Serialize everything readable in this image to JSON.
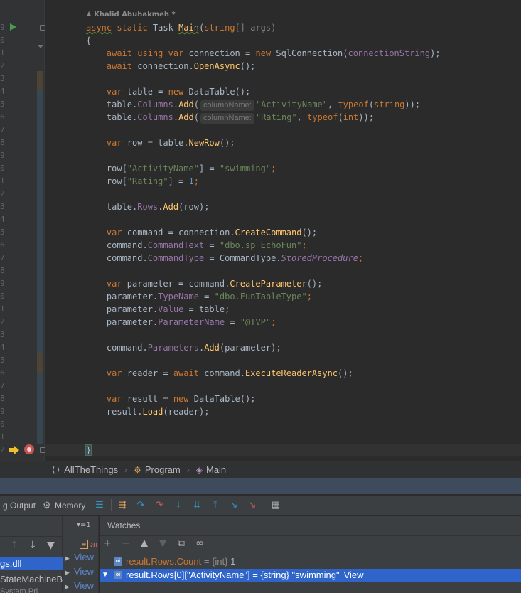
{
  "editor": {
    "author": "Khalid Abuhakmeh *",
    "line_numbers": [
      "9",
      "0",
      "1",
      "2",
      "3",
      "4",
      "5",
      "6",
      "7",
      "8",
      "9",
      "0",
      "1",
      "2",
      "3",
      "4",
      "5",
      "6",
      "7",
      "8",
      "9",
      "0",
      "1",
      "2",
      "3",
      "4",
      "5",
      "6",
      "7",
      "8",
      "9",
      "0",
      "1",
      "2"
    ],
    "code": {
      "l1_async": "async",
      "l1_static": " static",
      "l1_task": " Task ",
      "l1_main": "Main",
      "l1_paren": "(",
      "l1_string": "string",
      "l1_rest": "[] args)",
      "l2": "{",
      "l3_await": "    await",
      "l3_using": " using",
      "l3_var": " var",
      "l3_mid": " connection = ",
      "l3_new": "new",
      "l3_type": " SqlConnection(",
      "l3_arg": "connectionString",
      "l3_end": ");",
      "l4_await": "    await",
      "l4_mid": " connection.",
      "l4_fn": "OpenAsync",
      "l4_end": "();",
      "l5_var": "    var",
      "l5_mid": " table = ",
      "l5_new": "new",
      "l5_end": " DataTable();",
      "l6_a": "    table.",
      "l6_prop": "Columns",
      "l6_dot": ".",
      "l6_fn": "Add",
      "l6_paren": "(",
      "l6_hint": "columnName:",
      "l6_str": "\"ActivityName\"",
      "l6_comma": ", ",
      "l6_typeof": "typeof",
      "l6_p": "(",
      "l6_kw": "string",
      "l6_end": "));",
      "l7_a": "    table.",
      "l7_prop": "Columns",
      "l7_dot": ".",
      "l7_fn": "Add",
      "l7_paren": "(",
      "l7_hint": "columnName:",
      "l7_str": "\"Rating\"",
      "l7_comma": ", ",
      "l7_typeof": "typeof",
      "l7_p": "(",
      "l7_kw": "int",
      "l7_end": "));",
      "l8_var": "    var",
      "l8_mid": " row = table.",
      "l8_fn": "NewRow",
      "l8_end": "();",
      "l9_a": "    row[",
      "l9_str": "\"ActivityName\"",
      "l9_mid": "] = ",
      "l9_val": "\"swimming\"",
      "l9_end": ";",
      "l10_a": "    row[",
      "l10_str": "\"Rating\"",
      "l10_mid": "] = ",
      "l10_num": "1",
      "l10_end": ";",
      "l11_a": "    table.",
      "l11_prop": "Rows",
      "l11_dot": ".",
      "l11_fn": "Add",
      "l11_end": "(row);",
      "l12_var": "    var",
      "l12_mid": " command = connection.",
      "l12_fn": "CreateCommand",
      "l12_end": "();",
      "l13_a": "    command.",
      "l13_prop": "CommandText",
      "l13_mid": " = ",
      "l13_str": "\"dbo.sp_EchoFun\"",
      "l13_end": ";",
      "l14_a": "    command.",
      "l14_prop": "CommandType",
      "l14_mid": " = CommandType.",
      "l14_enum": "StoredProcedure",
      "l14_end": ";",
      "l15_var": "    var",
      "l15_mid": " parameter = command.",
      "l15_fn": "CreateParameter",
      "l15_end": "();",
      "l16_a": "    parameter.",
      "l16_prop": "TypeName",
      "l16_mid": " = ",
      "l16_str": "\"dbo.FunTableType\"",
      "l16_end": ";",
      "l17_a": "    parameter.",
      "l17_prop": "Value",
      "l17_end": " = table;",
      "l18_a": "    parameter.",
      "l18_prop": "ParameterName",
      "l18_mid": " = ",
      "l18_str": "\"@TVP\"",
      "l18_end": ";",
      "l19_a": "    command.",
      "l19_prop": "Parameters",
      "l19_dot": ".",
      "l19_fn": "Add",
      "l19_end": "(parameter);",
      "l20_var": "    var",
      "l20_mid": " reader = ",
      "l20_await": "await",
      "l20_mid2": " command.",
      "l20_fn": "ExecuteReaderAsync",
      "l20_end": "();",
      "l21_var": "    var",
      "l21_mid": " result = ",
      "l21_new": "new",
      "l21_end": " DataTable();",
      "l22_a": "    result.",
      "l22_fn": "Load",
      "l22_end": "(reader);",
      "l23": "}"
    }
  },
  "breadcrumbs": {
    "namespace_icon": "⟨⟩",
    "namespace": "AllTheThings",
    "class": "Program",
    "method": "Main",
    "separator": "›"
  },
  "debug_toolbar": {
    "output_tab": "g Output",
    "memory_tab": "Memory"
  },
  "frames": {
    "selected": "gs.dll",
    "item2": "StateMachineB",
    "item3": "System.Pri"
  },
  "variables": {
    "row_label": "ar",
    "items": [
      "View",
      "View",
      "View"
    ]
  },
  "watches": {
    "title": "Watches",
    "rows": [
      {
        "name": "result.Rows.Count",
        "rest": " = {int} ",
        "value": "1",
        "icon": "oi"
      },
      {
        "expression": "result.Rows[0][\"ActivityName\"] = {string} \"swimming\"",
        "link": "View",
        "icon": "oi"
      }
    ]
  },
  "colors": {
    "editor_bg": "#2b2b2b",
    "keyword": "#cc7832",
    "string": "#6a8759",
    "method": "#ffc66d",
    "property": "#9876aa",
    "number": "#6897bb",
    "selection": "#2f65ca"
  }
}
